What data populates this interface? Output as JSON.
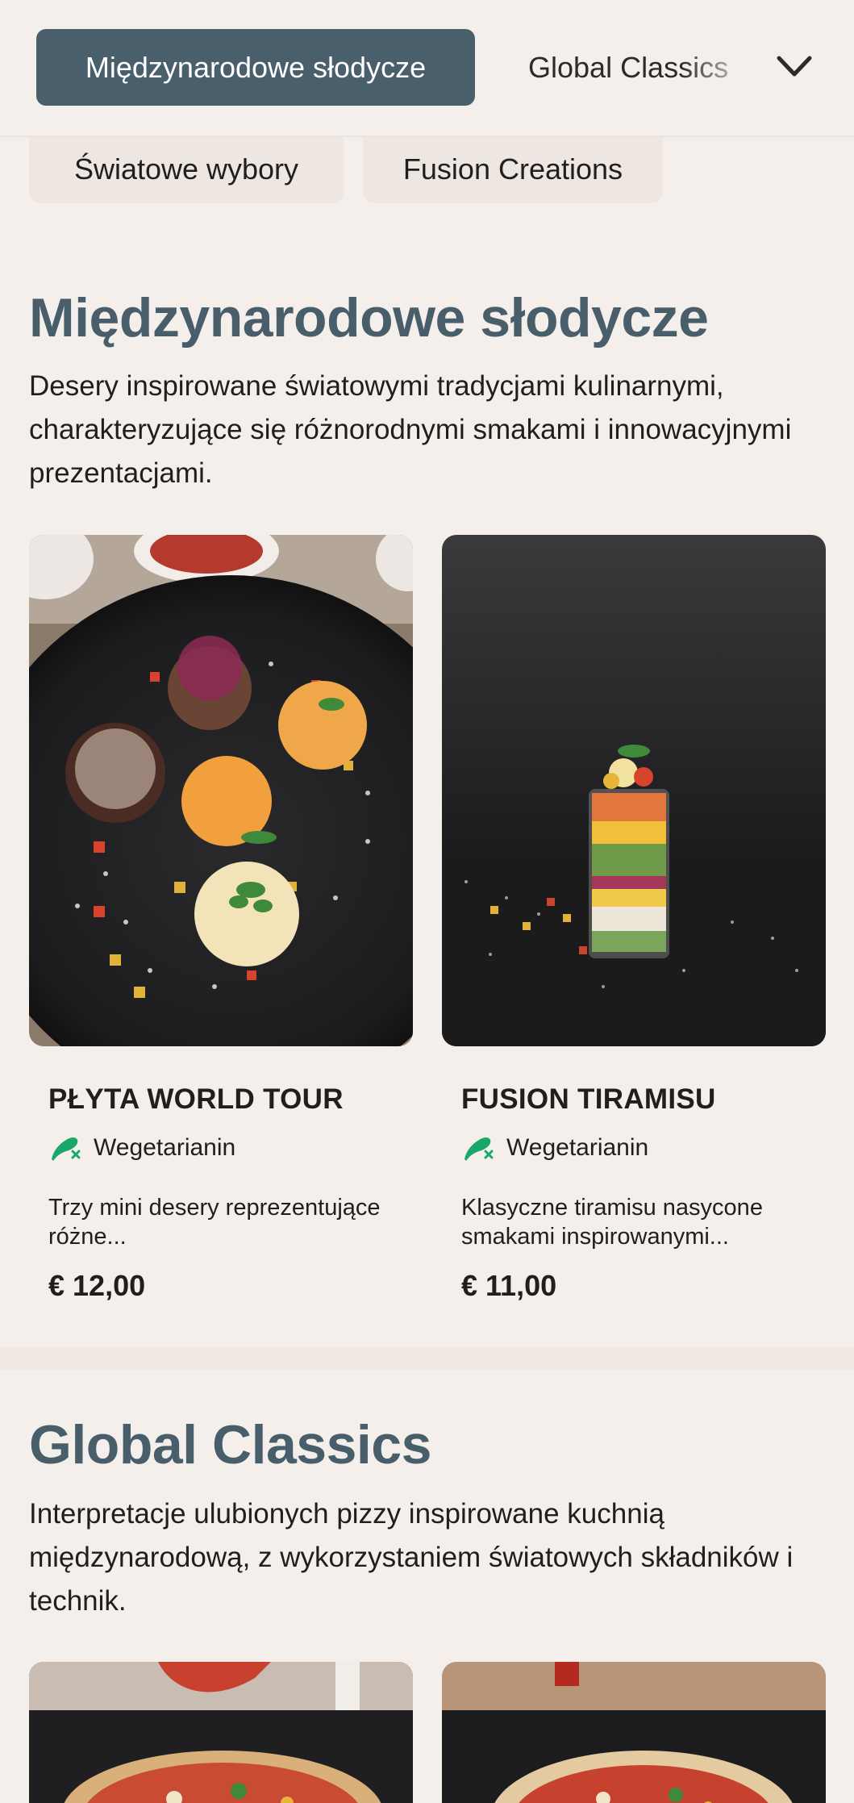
{
  "nav": {
    "active_tab": "Międzynarodowe słodycze",
    "next_tab": "Global Classics",
    "chips": [
      "Światowe wybory",
      "Fusion Creations"
    ]
  },
  "sections": [
    {
      "title": "Międzynarodowe słodycze",
      "description": "Desery inspirowane światowymi tradycjami kulinarnymi, charakteryzujące się różnorodnymi smakami i innowacyjnymi prezentacjami.",
      "items": [
        {
          "name": "PŁYTA WORLD TOUR",
          "diet": "Wegetarianin",
          "description": "Trzy mini desery reprezentujące różne...",
          "price": "€ 12,00"
        },
        {
          "name": "FUSION TIRAMISU",
          "diet": "Wegetarianin",
          "description": "Klasyczne tiramisu nasycone smakami inspirowanymi...",
          "price": "€ 11,00"
        }
      ]
    },
    {
      "title": "Global Classics",
      "description": "Interpretacje ulubionych pizzy inspirowane kuchnią międzynarodową, z wykorzystaniem światowych składników i technik."
    }
  ],
  "colors": {
    "background": "#f5efeb",
    "accent": "#4a5f6c",
    "veg_icon": "#1aa86a"
  },
  "icons": [
    "chevron-down-icon",
    "vegetarian-icon"
  ]
}
